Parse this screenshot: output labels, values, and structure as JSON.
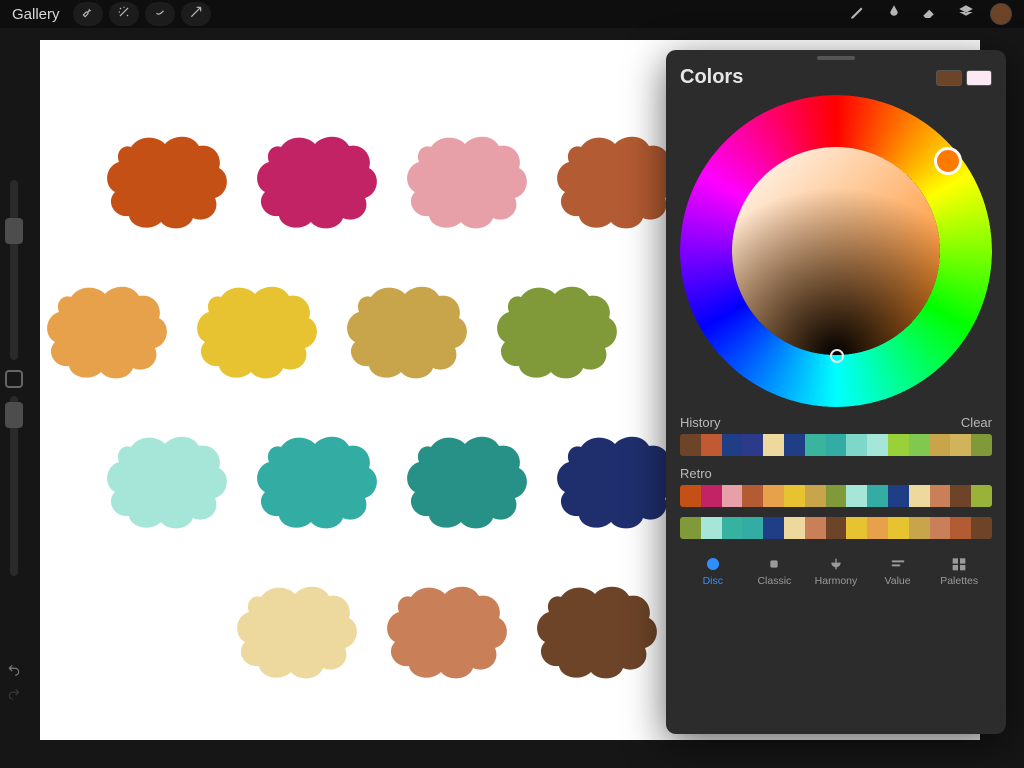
{
  "topbar": {
    "gallery_label": "Gallery",
    "current_color": "#6d4428"
  },
  "colors_panel": {
    "title": "Colors",
    "mini_swatches": [
      "#6d4428",
      "#fde9f4"
    ],
    "selected_hue": "#ff7a00",
    "history_label": "History",
    "clear_label": "Clear",
    "history_colors": [
      "#6d4428",
      "#c15a32",
      "#1f3e86",
      "#2c3a8a",
      "#edd99e",
      "#1f3e86",
      "#3ab49c",
      "#33aca3",
      "#7fd7c9",
      "#a6e6d8",
      "#99d238",
      "#80c850",
      "#c8a54a",
      "#d1b35b",
      "#809a3a"
    ],
    "retro_label": "Retro",
    "retro_colors": [
      "#c45016",
      "#c22364",
      "#e7a0a8",
      "#b35b32",
      "#e7a14a",
      "#e8c331",
      "#c8a54a",
      "#809a3a",
      "#a6e6d8",
      "#33aca3",
      "#1f3e86",
      "#edd99e",
      "#c97f57",
      "#6d4428",
      "#99b23a"
    ],
    "extra_colors": [
      "#809a3a",
      "#a6e6d8",
      "#36b3a0",
      "#33aca3",
      "#1f3e86",
      "#edd99e",
      "#c97f57",
      "#6d4428",
      "#e8c331",
      "#e7a14a",
      "#e8c331",
      "#c8a54a",
      "#c97f57",
      "#b35b32",
      "#6d4428"
    ],
    "tabs": [
      {
        "id": "disc",
        "label": "Disc",
        "active": true
      },
      {
        "id": "classic",
        "label": "Classic",
        "active": false
      },
      {
        "id": "harmony",
        "label": "Harmony",
        "active": false
      },
      {
        "id": "value",
        "label": "Value",
        "active": false
      },
      {
        "id": "palettes",
        "label": "Palettes",
        "active": false
      }
    ]
  },
  "canvas_swatches": {
    "row1": [
      "#c45016",
      "#c22364",
      "#e7a0a8",
      "#b35b32"
    ],
    "row2": [
      "#e7a14a",
      "#e8c331",
      "#c8a54a",
      "#809a3a"
    ],
    "row3": [
      "#a6e6d8",
      "#33aca3",
      "#279188",
      "#1f2f6e"
    ],
    "row4": [
      "#edd99e",
      "#c97f57",
      "#6d4428"
    ]
  }
}
